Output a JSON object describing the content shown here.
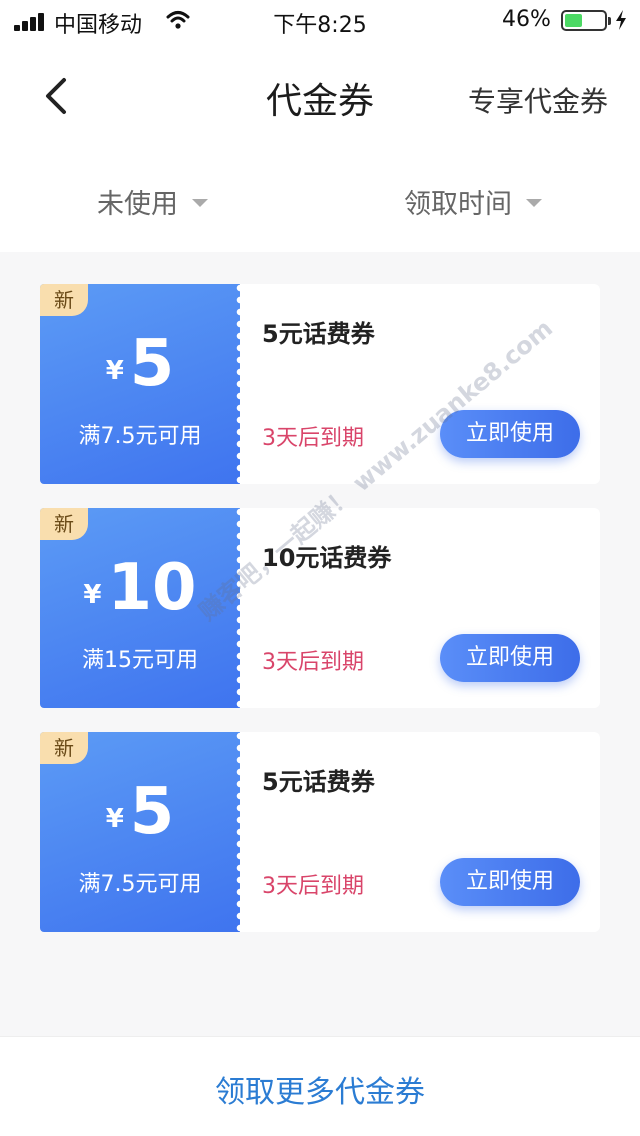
{
  "status_bar": {
    "carrier": "中国移动",
    "time": "下午8:25",
    "battery_percent": "46%",
    "battery_level": 0.46,
    "icons": [
      "signal-icon",
      "wifi-icon",
      "battery-icon",
      "charging-bolt-icon"
    ]
  },
  "nav": {
    "back_icon": "chevron-left-icon",
    "title": "代金券",
    "right_link": "专享代金券"
  },
  "filters": {
    "status": "未使用",
    "time": "领取时间"
  },
  "coupons": [
    {
      "badge": "新",
      "currency": "¥",
      "amount": "5",
      "min_spend": "满7.5元可用",
      "name": "5元话费券",
      "expiry": "3天后到期",
      "action": "立即使用"
    },
    {
      "badge": "新",
      "currency": "¥",
      "amount": "10",
      "min_spend": "满15元可用",
      "name": "10元话费券",
      "expiry": "3天后到期",
      "action": "立即使用"
    },
    {
      "badge": "新",
      "currency": "¥",
      "amount": "5",
      "min_spend": "满7.5元可用",
      "name": "5元话费券",
      "expiry": "3天后到期",
      "action": "立即使用"
    }
  ],
  "watermark": "赚客吧，一起赚！ www.zuanke8.com",
  "bottom": {
    "link": "领取更多代金券"
  },
  "colors": {
    "coupon_blue": "#3f74ef",
    "expiry_red": "#d9456a",
    "link_blue": "#2b7cd3",
    "badge_bg": "#f9deae"
  }
}
